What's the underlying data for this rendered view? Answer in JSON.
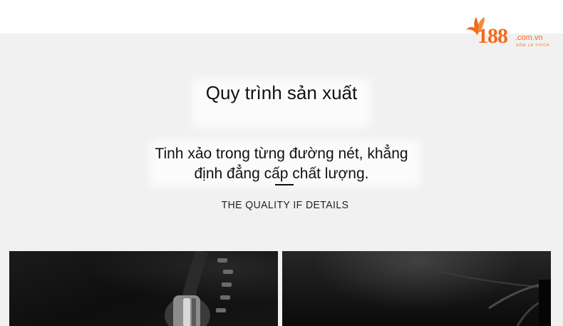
{
  "logo": {
    "number": "188",
    "domain": ".com.vn",
    "tagline": "SỐM LÀ THÍCH",
    "brand_color": "#f26b1d",
    "icon": "leaf-icon"
  },
  "heading": {
    "title": "Quy trình sản xuất",
    "subtitle": "Tinh xảo trong từng đường nét, khẳng định đẳng cấp chất lượng.",
    "quality": "THE QUALITY IF DETAILS"
  },
  "photos": [
    {
      "subject": "black leather with zipper detail"
    },
    {
      "subject": "black leather folded edge"
    }
  ]
}
